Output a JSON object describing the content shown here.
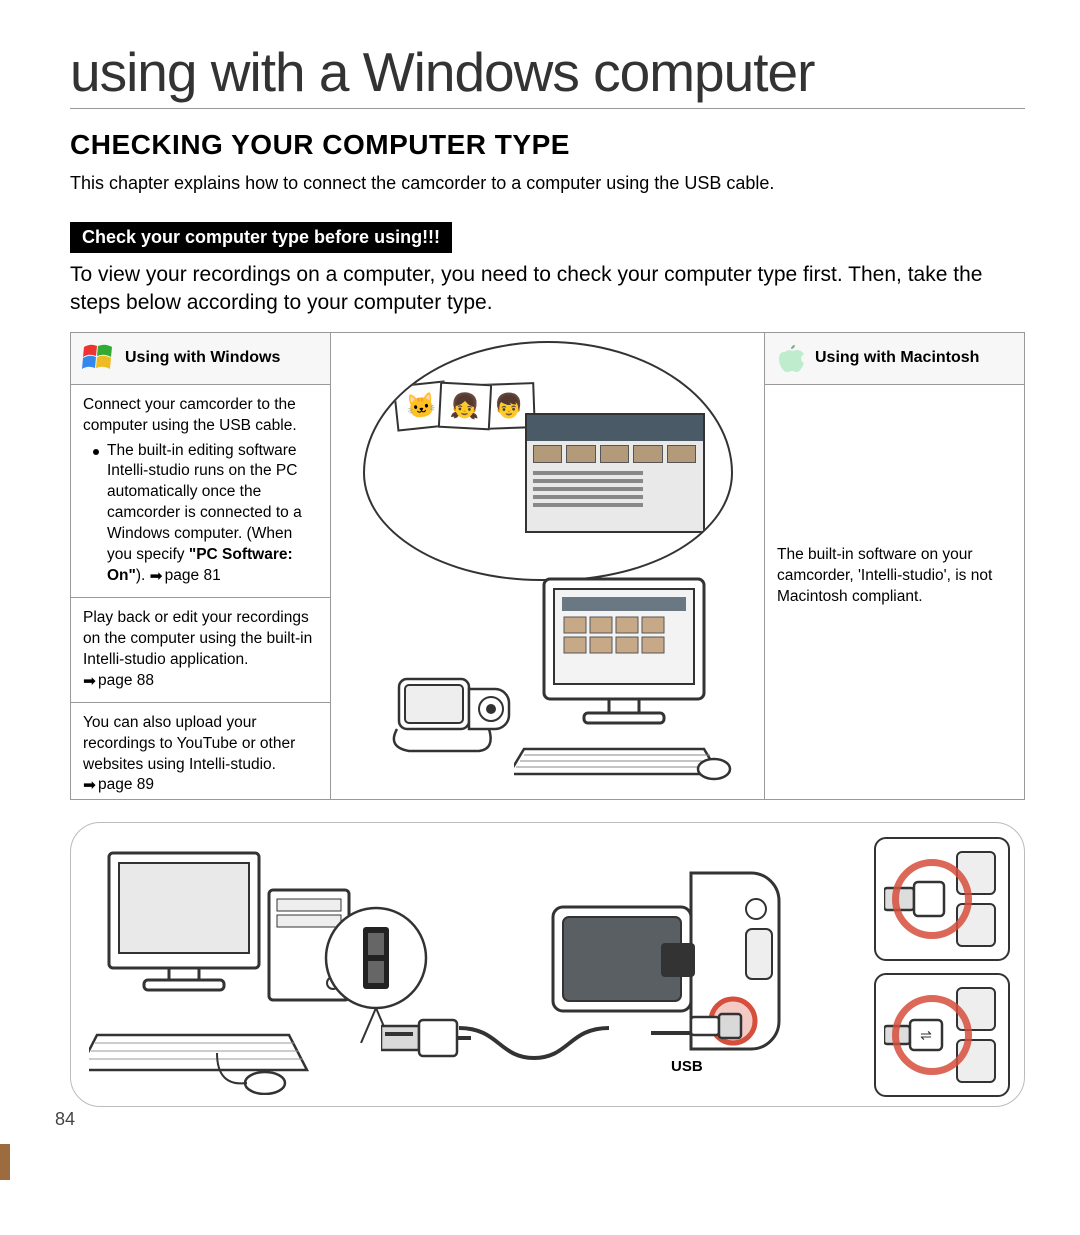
{
  "pageTitle": "using with a Windows computer",
  "sectionHeading": "CHECKING YOUR COMPUTER TYPE",
  "intro": "This chapter explains how to connect the camcorder to a computer using the USB cable.",
  "warnBar": "Check your computer type before using!!!",
  "warnDesc": "To view your recordings on a computer, you need to check your computer type first. Then, take the steps below according to your computer type.",
  "windows": {
    "header": "Using with Windows",
    "cell1_lead": "Connect your camcorder to the computer using the USB cable.",
    "cell1_bullet_pre": "The built-in editing software Intelli-studio runs on the PC automatically once the camcorder is connected to a Windows computer. (When you specify ",
    "cell1_bullet_bold": "\"PC Software: On\"",
    "cell1_bullet_post": "). ",
    "cell1_ref": "page 81",
    "cell2": "Play back or edit your recordings on the computer using the built-in Intelli-studio application.",
    "cell2_ref": "page 88",
    "cell3": "You can also upload your recordings to YouTube or other websites using Intelli-studio.",
    "cell3_ref": "page 89"
  },
  "mac": {
    "header": "Using with Macintosh",
    "cell1": "The built-in software on your camcorder, 'Intelli-studio', is not Macintosh compliant."
  },
  "usbLabel": "USB",
  "pageNumber": "84"
}
